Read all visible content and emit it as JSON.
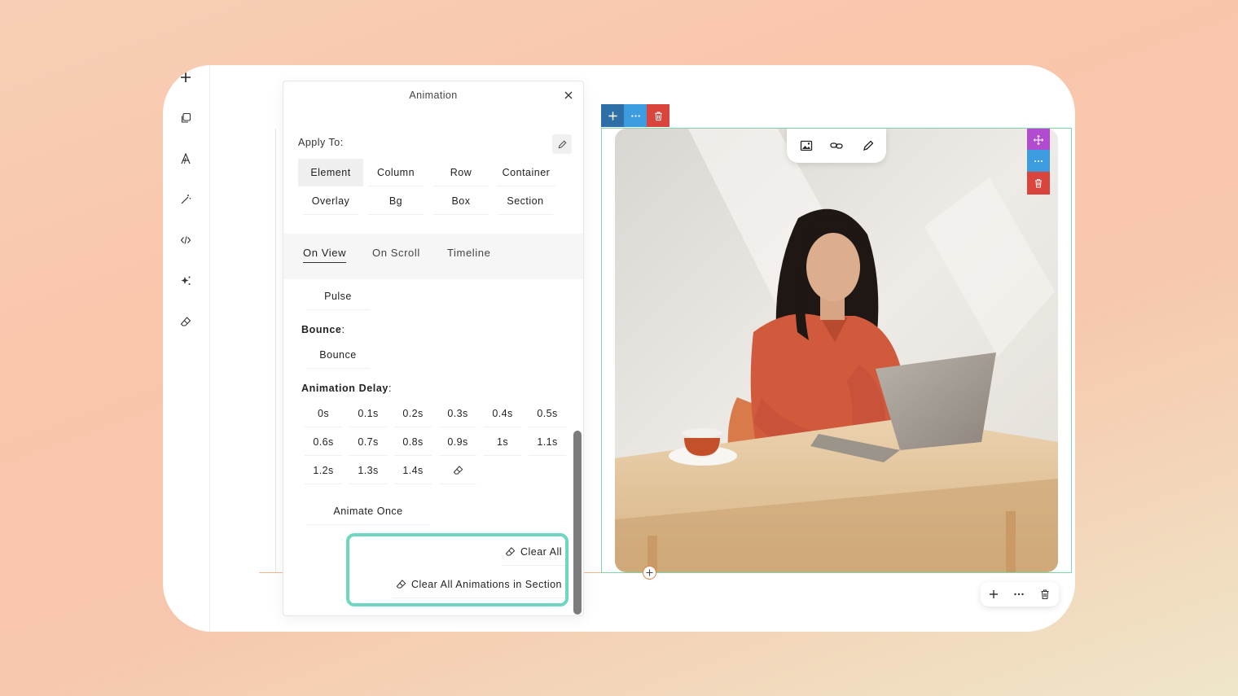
{
  "panel": {
    "title": "Animation",
    "apply_to_label": "Apply To:",
    "targets": [
      "Element",
      "Column",
      "Row",
      "Container",
      "Overlay",
      "Bg",
      "Box",
      "Section"
    ],
    "active_target": "Element",
    "tabs": [
      "On View",
      "On Scroll",
      "Timeline"
    ],
    "active_tab": "On View",
    "pulse_option": "Pulse",
    "bounce_label": "Bounce",
    "bounce_option": "Bounce",
    "delay_label": "Animation Delay",
    "delays": [
      "0s",
      "0.1s",
      "0.2s",
      "0.3s",
      "0.4s",
      "0.5s",
      "0.6s",
      "0.7s",
      "0.8s",
      "0.9s",
      "1s",
      "1.1s",
      "1.2s",
      "1.3s",
      "1.4s"
    ],
    "animate_once": "Animate Once",
    "clear_all": "Clear All",
    "clear_section": "Clear All Animations in Section"
  },
  "colors": {
    "highlight": "#6fd6c0",
    "add_blue": "#2f6fa8",
    "more_blue": "#3d9be0",
    "delete_red": "#d9453d",
    "move_purple": "#b24bd0",
    "selection_green": "#7fd6a8"
  }
}
